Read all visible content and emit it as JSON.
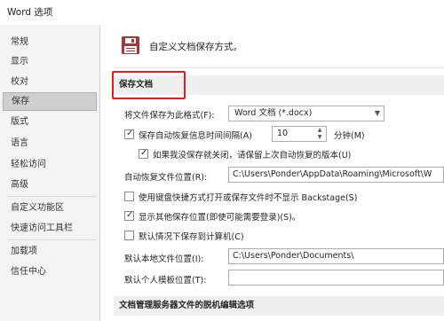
{
  "window": {
    "title": "Word 选项"
  },
  "sidebar": {
    "items": [
      {
        "label": "常规"
      },
      {
        "label": "显示"
      },
      {
        "label": "校对"
      },
      {
        "label": "保存"
      },
      {
        "label": "版式"
      },
      {
        "label": "语言"
      },
      {
        "label": "轻松访问"
      },
      {
        "label": "高级"
      },
      {
        "label": "自定义功能区"
      },
      {
        "label": "快速访问工具栏"
      },
      {
        "label": "加载项"
      },
      {
        "label": "信任中心"
      }
    ],
    "selected": "保存"
  },
  "main": {
    "header": "自定义文档保存方式。",
    "section_save": "保存文档",
    "save_format_label": "将文件保存为此格式(F):",
    "save_format_value": "Word 文档 (*.docx)",
    "autorecover_label": "保存自动恢复信息时间间隔(A)",
    "autorecover_value": "10",
    "autorecover_unit": "分钟(M)",
    "keep_last_label": "如果我没保存就关闭，请保留上次自动恢复的版本(U)",
    "autorecover_location_label": "自动恢复文件位置(R):",
    "autorecover_location_value": "C:\\Users\\Ponder\\AppData\\Roaming\\Microsoft\\W",
    "no_backstage_label": "使用键盘快捷方式打开或保存文件时不显示 Backstage(S)",
    "show_locations_label": "显示其他保存位置(即使可能需要登录)(S)。",
    "save_to_computer_label": "默认情况下保存到计算机(C)",
    "local_location_label": "默认本地文件位置(I):",
    "local_location_value": "C:\\Users\\Ponder\\Documents\\",
    "template_location_label": "默认个人模板位置(T):",
    "template_location_value": "",
    "section_offline": "文档管理服务器文件的脱机编辑选项"
  },
  "checkboxes": {
    "autorecover": true,
    "keep_last": true,
    "no_backstage": false,
    "show_locations": true,
    "save_to_computer": false
  },
  "colors": {
    "highlight_box": "#e02020",
    "sidebar_bg": "#f3f3f3",
    "selected_bg": "#cfcfcf",
    "save_icon": "#a4373a"
  }
}
